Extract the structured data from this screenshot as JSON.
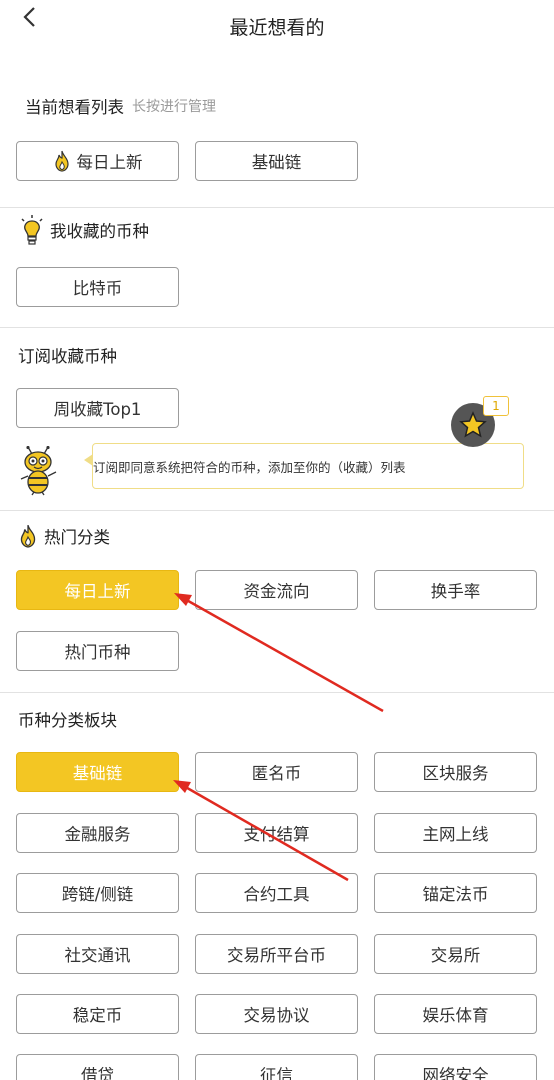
{
  "header": {
    "title": "最近想看的",
    "back_icon": "chevron-left-icon"
  },
  "current_list": {
    "title": "当前想看列表",
    "hint": "长按进行管理",
    "items": [
      {
        "label": "每日上新",
        "icon": "flame-icon"
      },
      {
        "label": "基础链"
      }
    ]
  },
  "favorites": {
    "title": "我收藏的币种",
    "icon": "lightbulb-icon",
    "items": [
      {
        "label": "比特币"
      }
    ]
  },
  "subscribe": {
    "title": "订阅收藏币种",
    "items": [
      {
        "label": "周收藏Top1"
      }
    ],
    "tooltip": "订阅即同意系统把符合的币种，添加至你的（收藏）列表",
    "fab_badge": "1",
    "fab_icon": "star-icon",
    "mascot_icon": "bee-mascot-icon"
  },
  "hot": {
    "title": "热门分类",
    "icon": "flame-icon",
    "items": [
      {
        "label": "每日上新",
        "active": true
      },
      {
        "label": "资金流向"
      },
      {
        "label": "换手率"
      },
      {
        "label": "热门币种"
      }
    ]
  },
  "categories": {
    "title": "币种分类板块",
    "items": [
      {
        "label": "基础链",
        "active": true
      },
      {
        "label": "匿名币"
      },
      {
        "label": "区块服务"
      },
      {
        "label": "金融服务"
      },
      {
        "label": "支付结算"
      },
      {
        "label": "主网上线"
      },
      {
        "label": "跨链/侧链"
      },
      {
        "label": "合约工具"
      },
      {
        "label": "锚定法币"
      },
      {
        "label": "社交通讯"
      },
      {
        "label": "交易所平台币"
      },
      {
        "label": "交易所"
      },
      {
        "label": "稳定币"
      },
      {
        "label": "交易协议"
      },
      {
        "label": "娱乐体育"
      },
      {
        "label": "借贷"
      },
      {
        "label": "征信"
      },
      {
        "label": "网络安全"
      }
    ]
  },
  "colors": {
    "accent": "#f3c623",
    "arrow": "#e02a20",
    "chip_border": "#9c9c9c"
  }
}
